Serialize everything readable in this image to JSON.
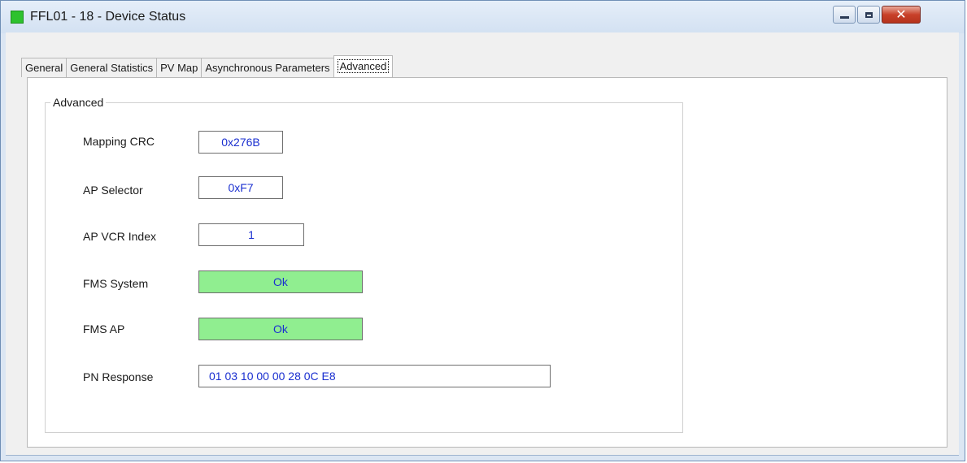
{
  "window": {
    "title": "FFL01 - 18 - Device Status",
    "icon_color": "#2ec22e",
    "controls": {
      "minimize": "minimize-icon",
      "maximize": "maximize-icon",
      "close": "close-icon"
    }
  },
  "tabs": [
    {
      "label": "General",
      "active": false
    },
    {
      "label": "General Statistics",
      "active": false
    },
    {
      "label": "PV Map",
      "active": false
    },
    {
      "label": "Asynchronous Parameters",
      "active": false
    },
    {
      "label": "Advanced",
      "active": true
    }
  ],
  "advanced": {
    "group_title": "Advanced",
    "fields": [
      {
        "label": "Mapping CRC",
        "value": "0x276B"
      },
      {
        "label": "AP Selector",
        "value": "0xF7"
      },
      {
        "label": "AP VCR Index",
        "value": "1"
      },
      {
        "label": "FMS System",
        "value": "Ok",
        "status_color": "#90ee90"
      },
      {
        "label": "FMS AP",
        "value": "Ok",
        "status_color": "#90ee90"
      },
      {
        "label": "PN Response",
        "value": "01 03 10 00 00 28 0C E8"
      }
    ]
  }
}
